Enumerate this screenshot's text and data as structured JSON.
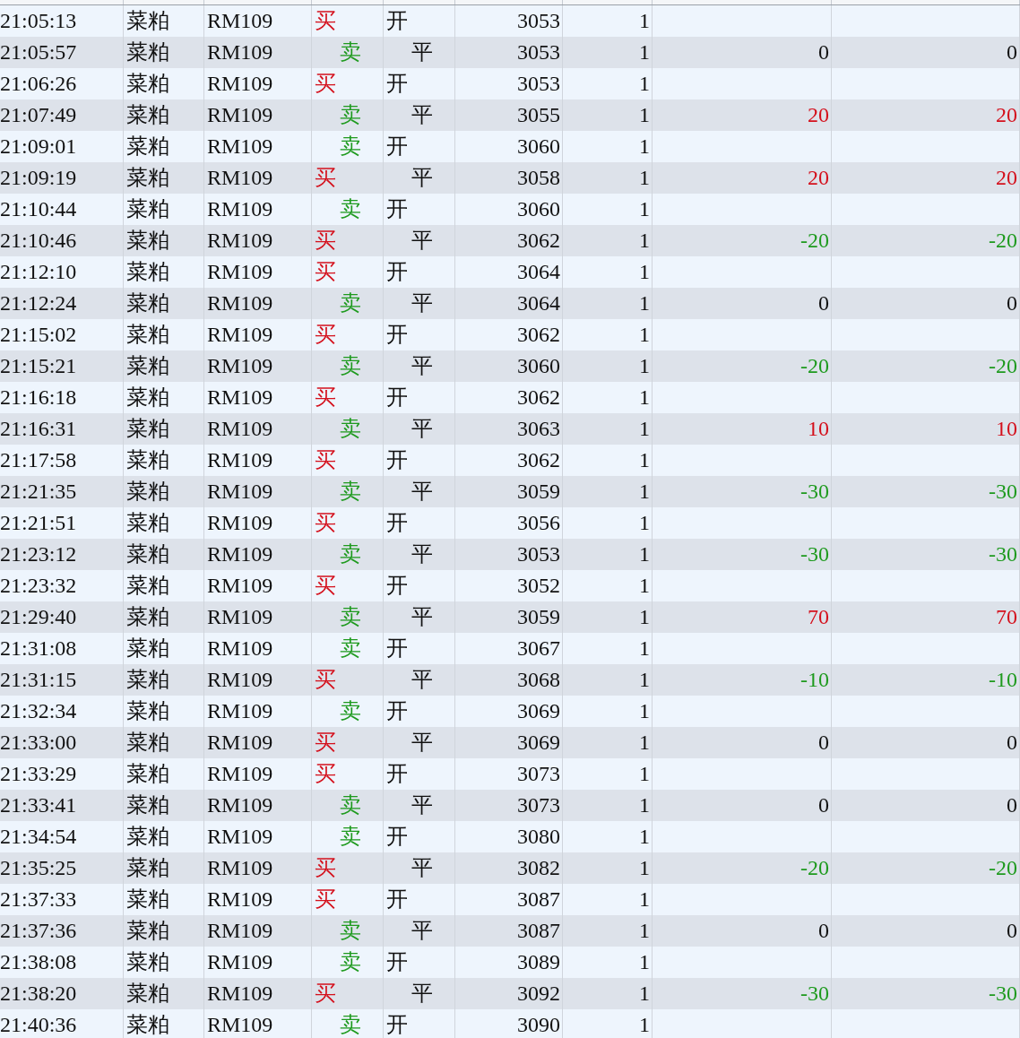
{
  "table": {
    "rows": [
      {
        "time": "21:05:13",
        "product": "菜粕",
        "contract": "RM109",
        "side": {
          "text": "买",
          "kind": "buy"
        },
        "offset": {
          "text": "开",
          "kind": "open"
        },
        "price": "3053",
        "qty": "1"
      },
      {
        "time": "21:05:57",
        "product": "菜粕",
        "contract": "RM109",
        "side": {
          "text": "卖",
          "kind": "sell"
        },
        "offset": {
          "text": "平",
          "kind": "close"
        },
        "price": "3053",
        "qty": "1",
        "pnl": {
          "trade": "0",
          "mark": "0",
          "kind": "flat"
        }
      },
      {
        "time": "21:06:26",
        "product": "菜粕",
        "contract": "RM109",
        "side": {
          "text": "买",
          "kind": "buy"
        },
        "offset": {
          "text": "开",
          "kind": "open"
        },
        "price": "3053",
        "qty": "1"
      },
      {
        "time": "21:07:49",
        "product": "菜粕",
        "contract": "RM109",
        "side": {
          "text": "卖",
          "kind": "sell"
        },
        "offset": {
          "text": "平",
          "kind": "close"
        },
        "price": "3055",
        "qty": "1",
        "pnl": {
          "trade": "20",
          "mark": "20",
          "kind": "gain"
        }
      },
      {
        "time": "21:09:01",
        "product": "菜粕",
        "contract": "RM109",
        "side": {
          "text": "卖",
          "kind": "sell"
        },
        "offset": {
          "text": "开",
          "kind": "open"
        },
        "price": "3060",
        "qty": "1"
      },
      {
        "time": "21:09:19",
        "product": "菜粕",
        "contract": "RM109",
        "side": {
          "text": "买",
          "kind": "buy"
        },
        "offset": {
          "text": "平",
          "kind": "close"
        },
        "price": "3058",
        "qty": "1",
        "pnl": {
          "trade": "20",
          "mark": "20",
          "kind": "gain"
        }
      },
      {
        "time": "21:10:44",
        "product": "菜粕",
        "contract": "RM109",
        "side": {
          "text": "卖",
          "kind": "sell"
        },
        "offset": {
          "text": "开",
          "kind": "open"
        },
        "price": "3060",
        "qty": "1"
      },
      {
        "time": "21:10:46",
        "product": "菜粕",
        "contract": "RM109",
        "side": {
          "text": "买",
          "kind": "buy"
        },
        "offset": {
          "text": "平",
          "kind": "close"
        },
        "price": "3062",
        "qty": "1",
        "pnl": {
          "trade": "-20",
          "mark": "-20",
          "kind": "loss"
        }
      },
      {
        "time": "21:12:10",
        "product": "菜粕",
        "contract": "RM109",
        "side": {
          "text": "买",
          "kind": "buy"
        },
        "offset": {
          "text": "开",
          "kind": "open"
        },
        "price": "3064",
        "qty": "1"
      },
      {
        "time": "21:12:24",
        "product": "菜粕",
        "contract": "RM109",
        "side": {
          "text": "卖",
          "kind": "sell"
        },
        "offset": {
          "text": "平",
          "kind": "close"
        },
        "price": "3064",
        "qty": "1",
        "pnl": {
          "trade": "0",
          "mark": "0",
          "kind": "flat"
        }
      },
      {
        "time": "21:15:02",
        "product": "菜粕",
        "contract": "RM109",
        "side": {
          "text": "买",
          "kind": "buy"
        },
        "offset": {
          "text": "开",
          "kind": "open"
        },
        "price": "3062",
        "qty": "1"
      },
      {
        "time": "21:15:21",
        "product": "菜粕",
        "contract": "RM109",
        "side": {
          "text": "卖",
          "kind": "sell"
        },
        "offset": {
          "text": "平",
          "kind": "close"
        },
        "price": "3060",
        "qty": "1",
        "pnl": {
          "trade": "-20",
          "mark": "-20",
          "kind": "loss"
        }
      },
      {
        "time": "21:16:18",
        "product": "菜粕",
        "contract": "RM109",
        "side": {
          "text": "买",
          "kind": "buy"
        },
        "offset": {
          "text": "开",
          "kind": "open"
        },
        "price": "3062",
        "qty": "1"
      },
      {
        "time": "21:16:31",
        "product": "菜粕",
        "contract": "RM109",
        "side": {
          "text": "卖",
          "kind": "sell"
        },
        "offset": {
          "text": "平",
          "kind": "close"
        },
        "price": "3063",
        "qty": "1",
        "pnl": {
          "trade": "10",
          "mark": "10",
          "kind": "gain"
        }
      },
      {
        "time": "21:17:58",
        "product": "菜粕",
        "contract": "RM109",
        "side": {
          "text": "买",
          "kind": "buy"
        },
        "offset": {
          "text": "开",
          "kind": "open"
        },
        "price": "3062",
        "qty": "1"
      },
      {
        "time": "21:21:35",
        "product": "菜粕",
        "contract": "RM109",
        "side": {
          "text": "卖",
          "kind": "sell"
        },
        "offset": {
          "text": "平",
          "kind": "close"
        },
        "price": "3059",
        "qty": "1",
        "pnl": {
          "trade": "-30",
          "mark": "-30",
          "kind": "loss"
        }
      },
      {
        "time": "21:21:51",
        "product": "菜粕",
        "contract": "RM109",
        "side": {
          "text": "买",
          "kind": "buy"
        },
        "offset": {
          "text": "开",
          "kind": "open"
        },
        "price": "3056",
        "qty": "1"
      },
      {
        "time": "21:23:12",
        "product": "菜粕",
        "contract": "RM109",
        "side": {
          "text": "卖",
          "kind": "sell"
        },
        "offset": {
          "text": "平",
          "kind": "close"
        },
        "price": "3053",
        "qty": "1",
        "pnl": {
          "trade": "-30",
          "mark": "-30",
          "kind": "loss"
        }
      },
      {
        "time": "21:23:32",
        "product": "菜粕",
        "contract": "RM109",
        "side": {
          "text": "买",
          "kind": "buy"
        },
        "offset": {
          "text": "开",
          "kind": "open"
        },
        "price": "3052",
        "qty": "1"
      },
      {
        "time": "21:29:40",
        "product": "菜粕",
        "contract": "RM109",
        "side": {
          "text": "卖",
          "kind": "sell"
        },
        "offset": {
          "text": "平",
          "kind": "close"
        },
        "price": "3059",
        "qty": "1",
        "pnl": {
          "trade": "70",
          "mark": "70",
          "kind": "gain"
        }
      },
      {
        "time": "21:31:08",
        "product": "菜粕",
        "contract": "RM109",
        "side": {
          "text": "卖",
          "kind": "sell"
        },
        "offset": {
          "text": "开",
          "kind": "open"
        },
        "price": "3067",
        "qty": "1"
      },
      {
        "time": "21:31:15",
        "product": "菜粕",
        "contract": "RM109",
        "side": {
          "text": "买",
          "kind": "buy"
        },
        "offset": {
          "text": "平",
          "kind": "close"
        },
        "price": "3068",
        "qty": "1",
        "pnl": {
          "trade": "-10",
          "mark": "-10",
          "kind": "loss"
        }
      },
      {
        "time": "21:32:34",
        "product": "菜粕",
        "contract": "RM109",
        "side": {
          "text": "卖",
          "kind": "sell"
        },
        "offset": {
          "text": "开",
          "kind": "open"
        },
        "price": "3069",
        "qty": "1"
      },
      {
        "time": "21:33:00",
        "product": "菜粕",
        "contract": "RM109",
        "side": {
          "text": "买",
          "kind": "buy"
        },
        "offset": {
          "text": "平",
          "kind": "close"
        },
        "price": "3069",
        "qty": "1",
        "pnl": {
          "trade": "0",
          "mark": "0",
          "kind": "flat"
        }
      },
      {
        "time": "21:33:29",
        "product": "菜粕",
        "contract": "RM109",
        "side": {
          "text": "买",
          "kind": "buy"
        },
        "offset": {
          "text": "开",
          "kind": "open"
        },
        "price": "3073",
        "qty": "1"
      },
      {
        "time": "21:33:41",
        "product": "菜粕",
        "contract": "RM109",
        "side": {
          "text": "卖",
          "kind": "sell"
        },
        "offset": {
          "text": "平",
          "kind": "close"
        },
        "price": "3073",
        "qty": "1",
        "pnl": {
          "trade": "0",
          "mark": "0",
          "kind": "flat"
        }
      },
      {
        "time": "21:34:54",
        "product": "菜粕",
        "contract": "RM109",
        "side": {
          "text": "卖",
          "kind": "sell"
        },
        "offset": {
          "text": "开",
          "kind": "open"
        },
        "price": "3080",
        "qty": "1"
      },
      {
        "time": "21:35:25",
        "product": "菜粕",
        "contract": "RM109",
        "side": {
          "text": "买",
          "kind": "buy"
        },
        "offset": {
          "text": "平",
          "kind": "close"
        },
        "price": "3082",
        "qty": "1",
        "pnl": {
          "trade": "-20",
          "mark": "-20",
          "kind": "loss"
        }
      },
      {
        "time": "21:37:33",
        "product": "菜粕",
        "contract": "RM109",
        "side": {
          "text": "买",
          "kind": "buy"
        },
        "offset": {
          "text": "开",
          "kind": "open"
        },
        "price": "3087",
        "qty": "1"
      },
      {
        "time": "21:37:36",
        "product": "菜粕",
        "contract": "RM109",
        "side": {
          "text": "卖",
          "kind": "sell"
        },
        "offset": {
          "text": "平",
          "kind": "close"
        },
        "price": "3087",
        "qty": "1",
        "pnl": {
          "trade": "0",
          "mark": "0",
          "kind": "flat"
        }
      },
      {
        "time": "21:38:08",
        "product": "菜粕",
        "contract": "RM109",
        "side": {
          "text": "卖",
          "kind": "sell"
        },
        "offset": {
          "text": "开",
          "kind": "open"
        },
        "price": "3089",
        "qty": "1"
      },
      {
        "time": "21:38:20",
        "product": "菜粕",
        "contract": "RM109",
        "side": {
          "text": "买",
          "kind": "buy"
        },
        "offset": {
          "text": "平",
          "kind": "close"
        },
        "price": "3092",
        "qty": "1",
        "pnl": {
          "trade": "-30",
          "mark": "-30",
          "kind": "loss"
        }
      },
      {
        "time": "21:40:36",
        "product": "菜粕",
        "contract": "RM109",
        "side": {
          "text": "卖",
          "kind": "sell"
        },
        "offset": {
          "text": "开",
          "kind": "open"
        },
        "price": "3090",
        "qty": "1"
      }
    ]
  }
}
